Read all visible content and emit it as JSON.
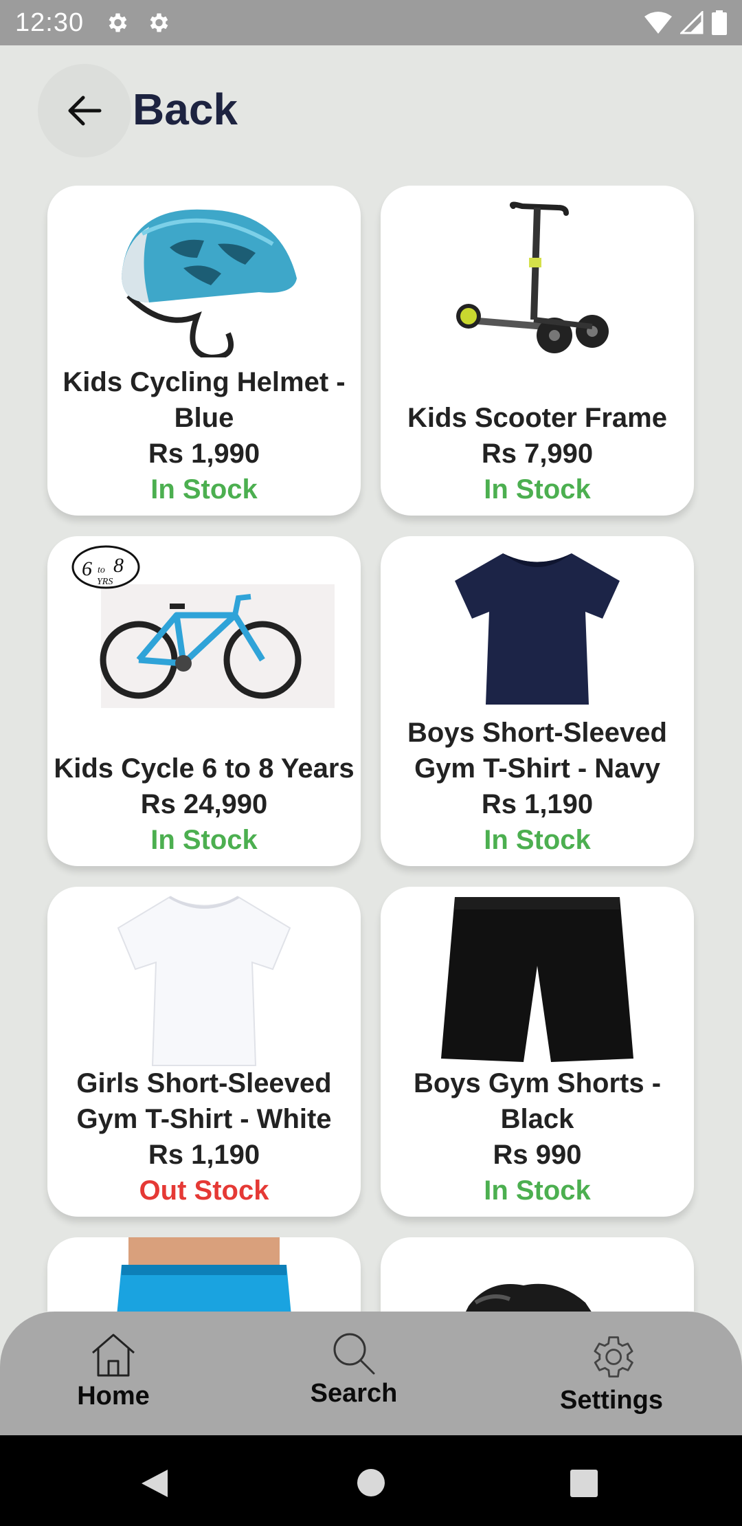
{
  "status_bar": {
    "time": "12:30",
    "icons": [
      "gear-icon",
      "gear-icon",
      "wifi-icon",
      "signal-icon",
      "battery-icon"
    ]
  },
  "header": {
    "back_icon": "arrow-left-icon",
    "title": "Back"
  },
  "products": [
    {
      "name": "Kids Cycling Helmet - Blue",
      "price": "Rs 1,990",
      "stock": "In Stock",
      "image": "helmet-icon"
    },
    {
      "name": "Kids Scooter Frame",
      "price": "Rs 7,990",
      "stock": "In Stock",
      "image": "scooter-icon"
    },
    {
      "name": "Kids Cycle 6 to 8 Years",
      "price": "Rs 24,990",
      "stock": "In Stock",
      "image": "bicycle-icon",
      "badge_number": "6",
      "badge_to": "to",
      "badge_number2": "8",
      "badge_unit": "YRS"
    },
    {
      "name": "Boys Short-Sleeved Gym T-Shirt - Navy",
      "price": "Rs 1,190",
      "stock": "In Stock",
      "image": "tshirt-navy-icon"
    },
    {
      "name": "Girls Short-Sleeved Gym T-Shirt - White",
      "price": "Rs 1,190",
      "stock": "Out Stock",
      "image": "tshirt-white-icon"
    },
    {
      "name": "Boys Gym Shorts - Black",
      "price": "Rs 990",
      "stock": "In Stock",
      "image": "shorts-black-icon"
    },
    {
      "name": "",
      "price": "",
      "stock": "",
      "image": "shorts-blue-icon"
    },
    {
      "name": "",
      "price": "",
      "stock": "",
      "image": "shoe-icon"
    }
  ],
  "bottom_nav": {
    "items": [
      {
        "label": "Home",
        "icon": "home-icon"
      },
      {
        "label": "Search",
        "icon": "search-icon"
      },
      {
        "label": "Settings",
        "icon": "gear-icon"
      }
    ]
  },
  "system_nav": {
    "icons": [
      "back-triangle-icon",
      "home-circle-icon",
      "recents-square-icon"
    ]
  },
  "colors": {
    "in_stock": "#4caf50",
    "out_stock": "#e53935",
    "title": "#1d2340",
    "background": "#e4e6e3"
  }
}
